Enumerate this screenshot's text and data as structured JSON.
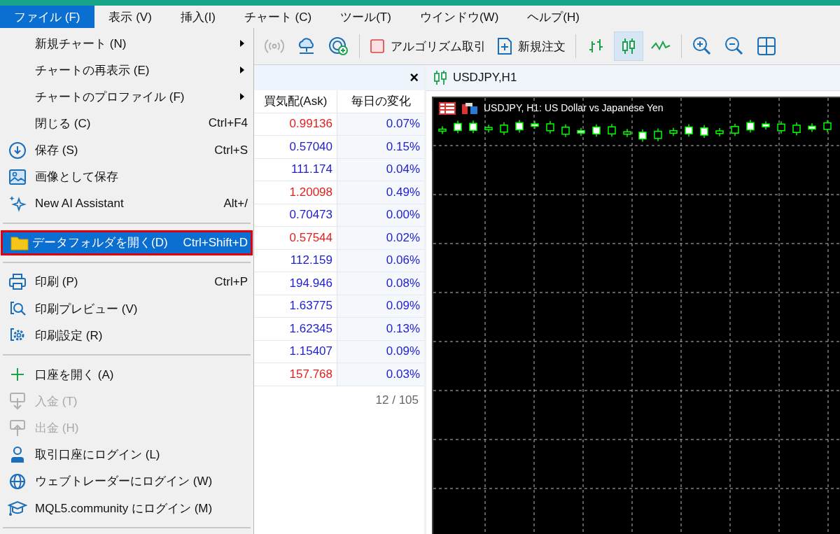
{
  "menubar": [
    {
      "label": "ファイル (F)",
      "selected": true
    },
    {
      "label": "表示 (V)",
      "selected": false
    },
    {
      "label": "挿入(I)",
      "selected": false
    },
    {
      "label": "チャート (C)",
      "selected": false
    },
    {
      "label": "ツール(T)",
      "selected": false
    },
    {
      "label": "ウインドウ(W)",
      "selected": false
    },
    {
      "label": "ヘルプ(H)",
      "selected": false
    }
  ],
  "file_menu": [
    [
      {
        "label": "新規チャート (N)",
        "submenu": true,
        "disabled": false,
        "selected": false
      },
      {
        "label": "チャートの再表示 (E)",
        "submenu": true,
        "disabled": false,
        "selected": false
      },
      {
        "label": "チャートのプロファイル (F)",
        "submenu": true,
        "disabled": false,
        "selected": false
      },
      {
        "label": "閉じる (C)",
        "shortcut": "Ctrl+F4",
        "submenu": false,
        "disabled": false,
        "selected": false
      },
      {
        "label": "保存 (S)",
        "shortcut": "Ctrl+S",
        "submenu": false,
        "disabled": false,
        "selected": false
      },
      {
        "label": "画像として保存",
        "submenu": false,
        "disabled": false,
        "selected": false
      },
      {
        "label": "New AI Assistant",
        "shortcut": "Alt+/",
        "submenu": false,
        "disabled": false,
        "selected": false
      }
    ],
    [
      {
        "label": "データフォルダを開く(D)",
        "shortcut": "Ctrl+Shift+D",
        "submenu": false,
        "disabled": false,
        "selected": true
      }
    ],
    [
      {
        "label": "印刷 (P)",
        "shortcut": "Ctrl+P",
        "submenu": false,
        "disabled": false,
        "selected": false
      },
      {
        "label": "印刷プレビュー (V)",
        "submenu": false,
        "disabled": false,
        "selected": false
      },
      {
        "label": "印刷設定 (R)",
        "submenu": false,
        "disabled": false,
        "selected": false
      }
    ],
    [
      {
        "label": "口座を開く (A)",
        "submenu": false,
        "disabled": false,
        "selected": false
      },
      {
        "label": "入金 (T)",
        "submenu": false,
        "disabled": true,
        "selected": false
      },
      {
        "label": "出金 (H)",
        "submenu": false,
        "disabled": true,
        "selected": false
      },
      {
        "label": "取引口座にログイン (L)",
        "submenu": false,
        "disabled": false,
        "selected": false
      },
      {
        "label": "ウェブトレーダーにログイン (W)",
        "submenu": false,
        "disabled": false,
        "selected": false
      },
      {
        "label": "MQL5.community にログイン (M)",
        "submenu": false,
        "disabled": false,
        "selected": false
      }
    ]
  ],
  "toolbar": [
    {
      "kind": "signal",
      "disabled": true
    },
    {
      "kind": "cloud"
    },
    {
      "kind": "radar"
    },
    {
      "kind": "separator"
    },
    {
      "kind": "algo",
      "label": "アルゴリズム取引"
    },
    {
      "kind": "order",
      "label": "新規注文"
    },
    {
      "kind": "separator"
    },
    {
      "kind": "bars",
      "selected": false
    },
    {
      "kind": "candles",
      "selected": true
    },
    {
      "kind": "line",
      "selected": false
    },
    {
      "kind": "separator"
    },
    {
      "kind": "zoom_in"
    },
    {
      "kind": "zoom_out"
    },
    {
      "kind": "tile"
    }
  ],
  "market_watch": {
    "close": "×",
    "columns": [
      "買気配(Ask)",
      "毎日の変化"
    ],
    "rows": [
      {
        "ask": "0.99136",
        "change": "0.07%",
        "color": "#e02020"
      },
      {
        "ask": "0.57040",
        "change": "0.15%",
        "color": "#2020d0"
      },
      {
        "ask": "111.174",
        "change": "0.04%",
        "color": "#2020d0"
      },
      {
        "ask": "1.20098",
        "change": "0.49%",
        "color": "#e02020"
      },
      {
        "ask": "0.70473",
        "change": "0.00%",
        "color": "#2020d0"
      },
      {
        "ask": "0.57544",
        "change": "0.02%",
        "color": "#e02020"
      },
      {
        "ask": "112.159",
        "change": "0.06%",
        "color": "#2020d0"
      },
      {
        "ask": "194.946",
        "change": "0.08%",
        "color": "#2020d0"
      },
      {
        "ask": "1.63775",
        "change": "0.09%",
        "color": "#2020d0"
      },
      {
        "ask": "1.62345",
        "change": "0.13%",
        "color": "#2020d0"
      },
      {
        "ask": "1.15407",
        "change": "0.09%",
        "color": "#2020d0"
      },
      {
        "ask": "157.768",
        "change": "0.03%",
        "color": "#e02020"
      }
    ],
    "footer": "12 / 105"
  },
  "chart": {
    "tab": "USDJPY,H1",
    "title": "USDJPY, H1:  US Dollar vs Japanese Yen"
  }
}
